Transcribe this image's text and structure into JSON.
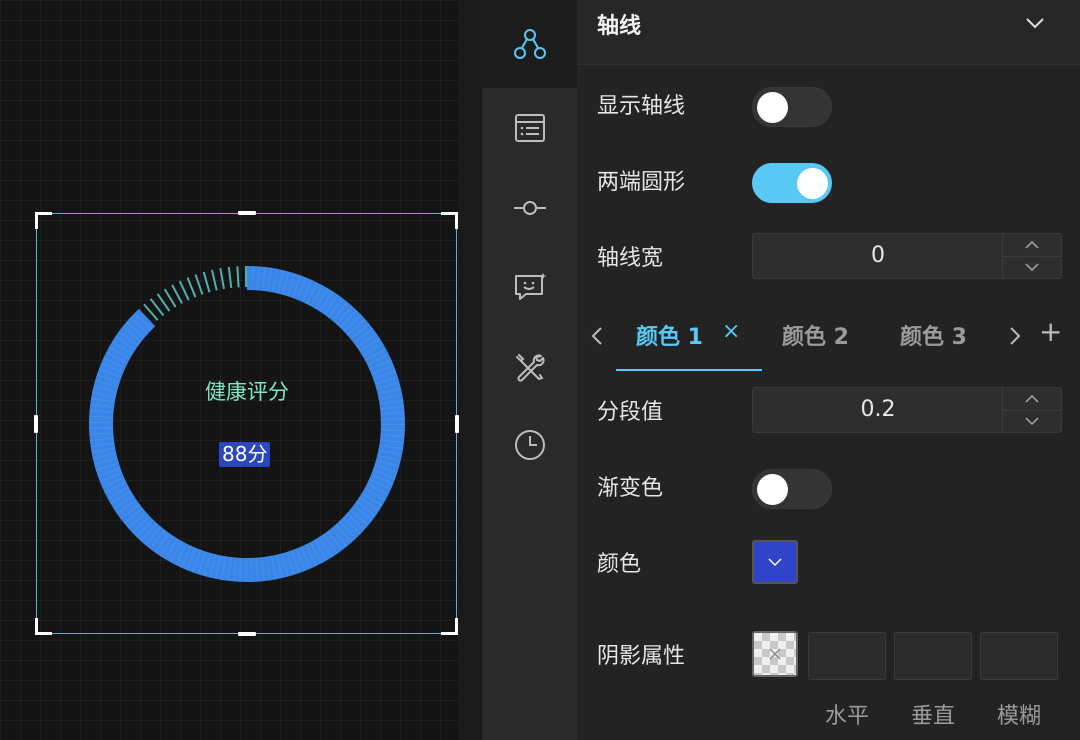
{
  "gauge": {
    "title": "健康评分",
    "value_text": "88分",
    "progress": 0.88,
    "track_color": "#3a86e8",
    "tick_color": "#4fb0b0",
    "title_color": "#7fe8c8",
    "value_bg": "#2c45c0"
  },
  "iconbar": {
    "items": [
      {
        "icon": "graph-nodes-icon",
        "active": true
      },
      {
        "icon": "list-document-icon",
        "active": false
      },
      {
        "icon": "commit-node-icon",
        "active": false
      },
      {
        "icon": "chat-smile-icon",
        "active": false
      },
      {
        "icon": "tools-icon",
        "active": false
      },
      {
        "icon": "clock-icon",
        "active": false
      }
    ]
  },
  "panel": {
    "section_title": "轴线",
    "show_axis": {
      "label": "显示轴线",
      "on": false
    },
    "round_ends": {
      "label": "两端圆形",
      "on": true
    },
    "axis_width": {
      "label": "轴线宽",
      "value": "0"
    },
    "color_tabs": {
      "items": [
        "颜色 1",
        "颜色 2",
        "颜色 3"
      ],
      "active_index": 0,
      "add_symbol": "+",
      "close_symbol": "×"
    },
    "segment": {
      "label": "分段值",
      "value": "0.2"
    },
    "gradient": {
      "label": "渐变色",
      "on": false
    },
    "color": {
      "label": "颜色",
      "value": "#2f44c9"
    },
    "shadow": {
      "label": "阴影属性",
      "fields": [
        "水平",
        "垂直",
        "模糊"
      ]
    },
    "accent_color": "#5ac8f5"
  }
}
